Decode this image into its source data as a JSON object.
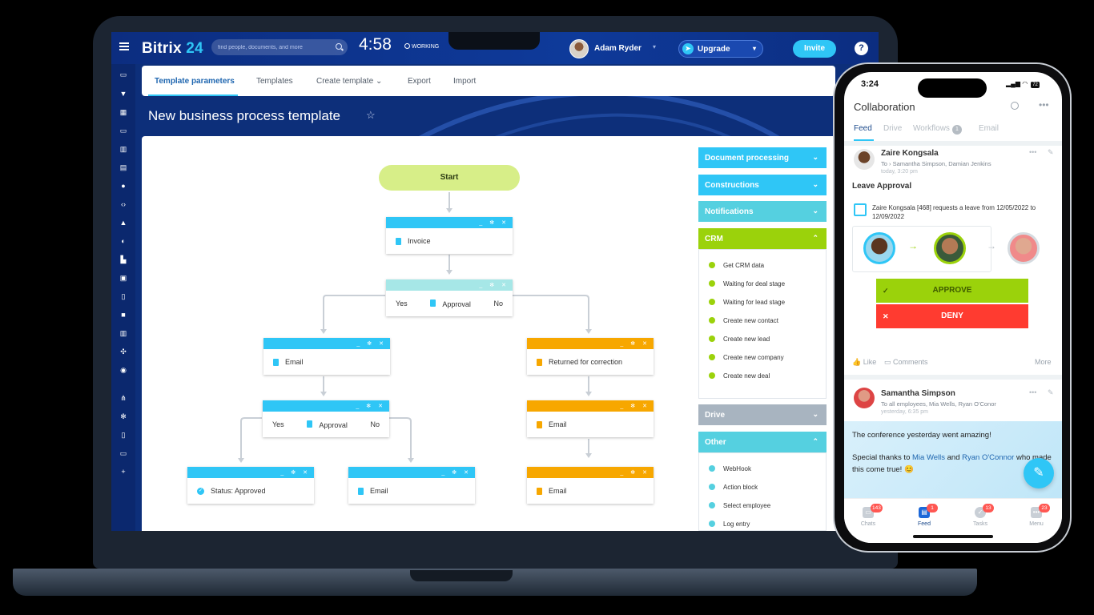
{
  "laptop": {
    "topbar": {
      "logo_main": "Bitrix",
      "logo_num": "24",
      "search_placeholder": "find people, documents, and more",
      "time": "4:58",
      "work_status": "WORKING",
      "user_name": "Adam Ryder",
      "upgrade_label": "Upgrade",
      "invite_label": "Invite",
      "help_label": "?"
    },
    "tabs": [
      "Template parameters",
      "Templates",
      "Create template",
      "Export",
      "Import"
    ],
    "page_title": "New business process template",
    "flow": {
      "start": "Start",
      "invoice": "Invoice",
      "approval1": "Approval",
      "yes": "Yes",
      "no": "No",
      "email_left": "Email",
      "approval2": "Approval",
      "status_approved": "Status: Approved",
      "email_mid": "Email",
      "returned": "Returned for correction",
      "email_r1": "Email",
      "email_r2": "Email"
    },
    "palette": {
      "doc_processing": "Document processing",
      "constructions": "Constructions",
      "notifications": "Notifications",
      "crm": "CRM",
      "crm_items": [
        "Get CRM data",
        "Waiting for deal stage",
        "Waiting for lead stage",
        "Create new contact",
        "Create new lead",
        "Create new company",
        "Create new deal"
      ],
      "drive": "Drive",
      "other": "Other",
      "other_items": [
        "WebHook",
        "Action block",
        "Select employee",
        "Log entry"
      ]
    },
    "colors": {
      "accent": "#2fc6f6",
      "brand": "#0d2f7a",
      "crm_green": "#9bd20b",
      "orange": "#f7a700"
    }
  },
  "phone": {
    "time": "3:24",
    "battery": "72",
    "title": "Collaboration",
    "tabs": [
      "Feed",
      "Drive",
      "Workflows",
      "Email"
    ],
    "workflows_badge": "1",
    "post1": {
      "author": "Zaire Kongsala",
      "to_prefix": "To",
      "recipients": "Samantha Simpson, Damian Jenkins",
      "time": "today, 3:20 pm",
      "title": "Leave Approval",
      "request_text": "Zaire Kongsala [468] requests a leave from 12/05/2022 to 12/09/2022",
      "approve": "APPROVE",
      "deny": "DENY",
      "like": "Like",
      "comments": "Comments",
      "more": "More"
    },
    "post2": {
      "author": "Samantha Simpson",
      "to_prefix": "To all employees,",
      "recipients": "Mia Wells, Ryan O'Conor",
      "time": "yesterday, 6:35 pm",
      "line1": "The conference yesterday went amazing!",
      "line2_a": "Special thanks to",
      "mention1": "Mia Wells",
      "and": "and",
      "mention2": "Ryan O'Connor",
      "line2_b": "who made this come true!"
    },
    "bottom_nav": [
      {
        "label": "Chats",
        "badge": "143"
      },
      {
        "label": "Feed",
        "badge": "1"
      },
      {
        "label": "Tasks",
        "badge": "13"
      },
      {
        "label": "Menu",
        "badge": "23"
      }
    ]
  }
}
